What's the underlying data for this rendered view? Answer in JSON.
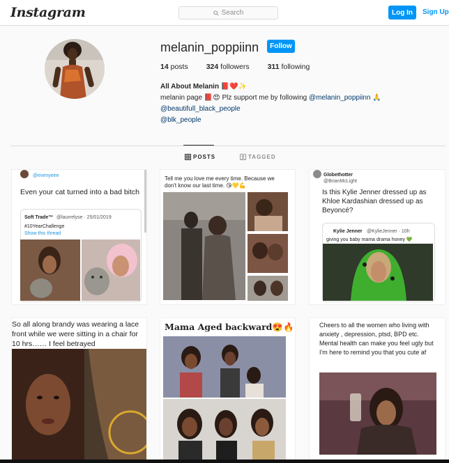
{
  "topbar": {
    "logo": "Instagram",
    "search_placeholder": "Search",
    "login_label": "Log In",
    "signup_label": "Sign Up"
  },
  "profile": {
    "username": "melanin_poppiinn",
    "follow_label": "Follow",
    "stats": [
      {
        "value": "14",
        "label": " posts"
      },
      {
        "value": "324",
        "label": " followers"
      },
      {
        "value": "311",
        "label": " following"
      }
    ],
    "bio_name": "All About Melanin 📕❤️✨",
    "bio_line1": "melanin page 📕😍 Plz support me by following ",
    "bio_mention1": "@melanin_poppiinn",
    "bio_pray": " 🙏",
    "bio_mention2": "@beautifull_black_people",
    "bio_mention3": "@blk_people"
  },
  "tabs": {
    "posts": "POSTS",
    "tagged": "TAGGED"
  },
  "posts": {
    "p1": {
      "handle": "@evenyeee",
      "text": "Even your cat turned into a bad bitch",
      "quote_name": "Soft Trade™",
      "quote_meta": "@laurrelyse · 25/01/2019",
      "quote_tag": "#10YearChallenge",
      "quote_link": "Show this thread"
    },
    "p2": {
      "text": "Tell me you love me every time. Because we don't know our last time. 😘💛💪"
    },
    "p3": {
      "name": "Globethotter",
      "handle": "@BrianMcLight",
      "text": "Is this Kylie Jenner dressed up as Khloe Kardashian dressed up as Beyoncé?",
      "quote_name": "Kylie Jenner",
      "quote_meta": "@KylieJenner · 10h",
      "quote_text": "giving you baby mama drama honey 💚"
    },
    "p4": {
      "text": "So all along brandy was wearing a lace front while we were sitting in a chair for 10 hrs…… I feel betrayed"
    },
    "p5": {
      "text": "Mama Aged backward😍🔥"
    },
    "p6": {
      "text": "Cheers to all the women who living with anxiety , depression, ptsd, BPD etc. Mental health can make you feel ugly but I'm here to remind you that you cute af"
    }
  },
  "colors": {
    "accent": "#0095f6",
    "link": "#00376b",
    "border": "#dbdbdb",
    "background": "#fafafa"
  }
}
